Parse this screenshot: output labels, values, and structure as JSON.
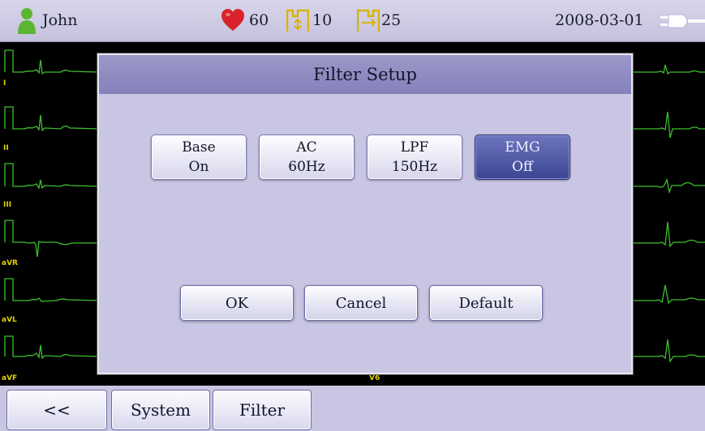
{
  "status_bar": {
    "patient_name": "John",
    "heart_rate": "60",
    "speed_value": "10",
    "gain_value": "25",
    "date": "2008-03-01",
    "icons": [
      "patient-icon",
      "heart-icon",
      "speed-icon",
      "gain-icon",
      "power-plug-icon"
    ],
    "heart_color": "#d8232a",
    "patient_icon_color": "#5bb531"
  },
  "ecg": {
    "leads": [
      "I",
      "II",
      "III",
      "aVR",
      "aVL",
      "aVF"
    ],
    "right_lead_label": "V6",
    "trace_color": "#3dbf2e",
    "label_color": "#e0d200"
  },
  "dialog": {
    "title": "Filter Setup",
    "options": [
      {
        "name": "Base",
        "value": "On",
        "selected": false
      },
      {
        "name": "AC",
        "value": "60Hz",
        "selected": false
      },
      {
        "name": "LPF",
        "value": "150Hz",
        "selected": false
      },
      {
        "name": "EMG",
        "value": "Off",
        "selected": true
      }
    ],
    "actions": {
      "ok": "OK",
      "cancel": "Cancel",
      "default": "Default"
    }
  },
  "bottom_bar": {
    "back": "<<",
    "system": "System",
    "filter": "Filter"
  }
}
